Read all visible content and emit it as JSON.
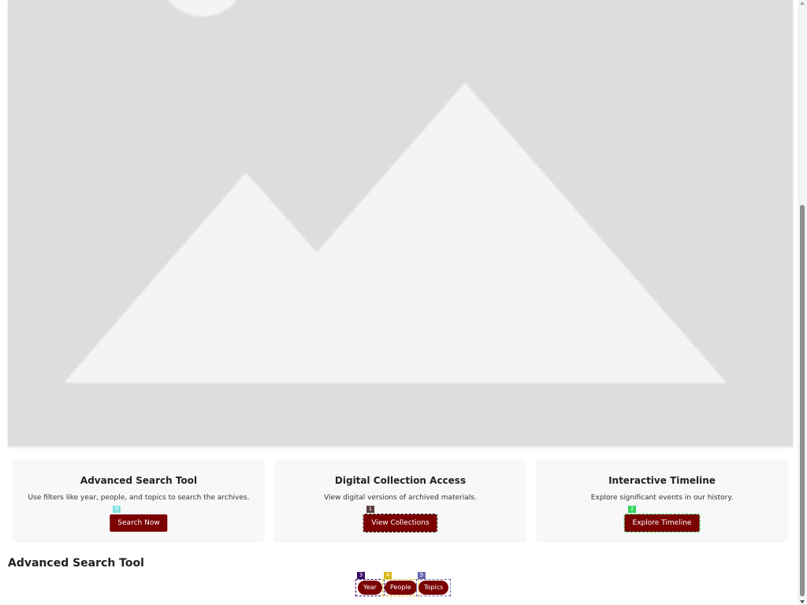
{
  "hero": {
    "image_icon": "image-placeholder-icon"
  },
  "cards": [
    {
      "title": "Advanced Search Tool",
      "description": "Use filters like year, people, and topics to search the archives.",
      "button_label": "Search Now",
      "marker": "0",
      "marker_color": "#7fe0e0"
    },
    {
      "title": "Digital Collection Access",
      "description": "View digital versions of archived materials.",
      "button_label": "View Collections",
      "marker": "1",
      "marker_color": "#5a3a3a"
    },
    {
      "title": "Interactive Timeline",
      "description": "Explore significant events in our history.",
      "button_label": "Explore Timeline",
      "marker": "2",
      "marker_color": "#2fd35a"
    }
  ],
  "search_section": {
    "heading": "Advanced Search Tool",
    "filters": [
      {
        "label": "Year",
        "marker": "3",
        "marker_color": "#3a0a6a"
      },
      {
        "label": "People",
        "marker": "4",
        "marker_color": "#d6b81a"
      },
      {
        "label": "Topics",
        "marker": "5",
        "marker_color": "#6a6ab0"
      }
    ]
  },
  "colors": {
    "accent": "#7b0000",
    "hero_bg": "#dddddd",
    "hero_shapes": "#f4f4f4",
    "card_bg": "#f8f8f8"
  }
}
